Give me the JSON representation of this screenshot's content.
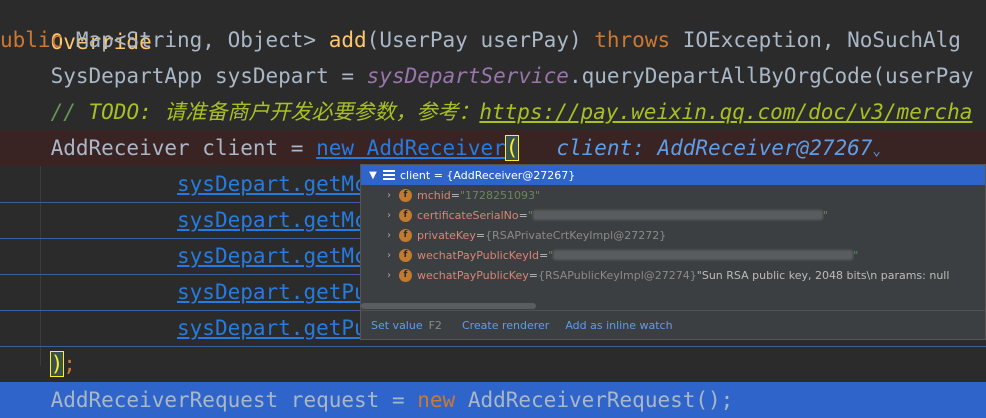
{
  "code": {
    "line0": {
      "text": "Override"
    },
    "line1": {
      "kw_public": "ublic ",
      "type": "Map<String, Object> ",
      "method": "add",
      "params": "(UserPay userPay) ",
      "kw_throws": "throws ",
      "exceptions": "IOException, NoSuchAlg"
    },
    "line2": {
      "decl": "SysDepartApp sysDepart = ",
      "service": "sysDepartService",
      "call": ".queryDepartAllByOrgCode(userPay"
    },
    "line3": {
      "slashes": "// ",
      "todo": "TODO: 请准备商户开发必要参数，参考：",
      "url": "https://pay.weixin.qq.com/doc/v3/mercha"
    },
    "line4": {
      "decl": "AddReceiver client = ",
      "kw_new": "new",
      "ctor": " AddReceiver",
      "paren": "(",
      "hint": "client: AddReceiver@27267",
      "hint_arrow": "⌄"
    },
    "line5": {
      "text": "sysDepart.getMchi"
    },
    "line6": {
      "text": "sysDepart.getMchs"
    },
    "line7": {
      "text": "sysDepart.getMchs"
    },
    "line8": {
      "text": "sysDepart.getPubk"
    },
    "line9": {
      "text": "sysDepart.getPubk"
    },
    "line10": {
      "paren": ")",
      "semi": ";"
    },
    "line11": {
      "decl": "AddReceiverRequest request = ",
      "kw_new": "new",
      "rest": " AddReceiverRequest();"
    }
  },
  "debug_popup": {
    "root_label": "client = {AddReceiver@27267}",
    "fields": [
      {
        "icon": "f",
        "name": "mchid",
        "eq": " = ",
        "value": "\"1728251093\""
      },
      {
        "icon": "f",
        "name": "certificateSerialNo",
        "eq": " = ",
        "value": "\"",
        "value_end": "\""
      },
      {
        "icon": "f",
        "name": "privateKey",
        "eq": " = ",
        "value": "{RSAPrivateCrtKeyImpl@27272}"
      },
      {
        "icon": "f",
        "name": "wechatPayPublicKeyId",
        "eq": " = ",
        "value": "\"",
        "value_end": "\""
      },
      {
        "icon": "f",
        "name": "wechatPayPublicKey",
        "eq": " = ",
        "value": "{RSAPublicKeyImpl@27274}",
        "extra": "\"Sun RSA public key, 2048 bits\\n  params: null"
      }
    ],
    "footer": {
      "set_value": "Set value",
      "set_value_key": "F2",
      "create_renderer": "Create renderer",
      "add_inline_watch": "Add as inline watch"
    }
  }
}
